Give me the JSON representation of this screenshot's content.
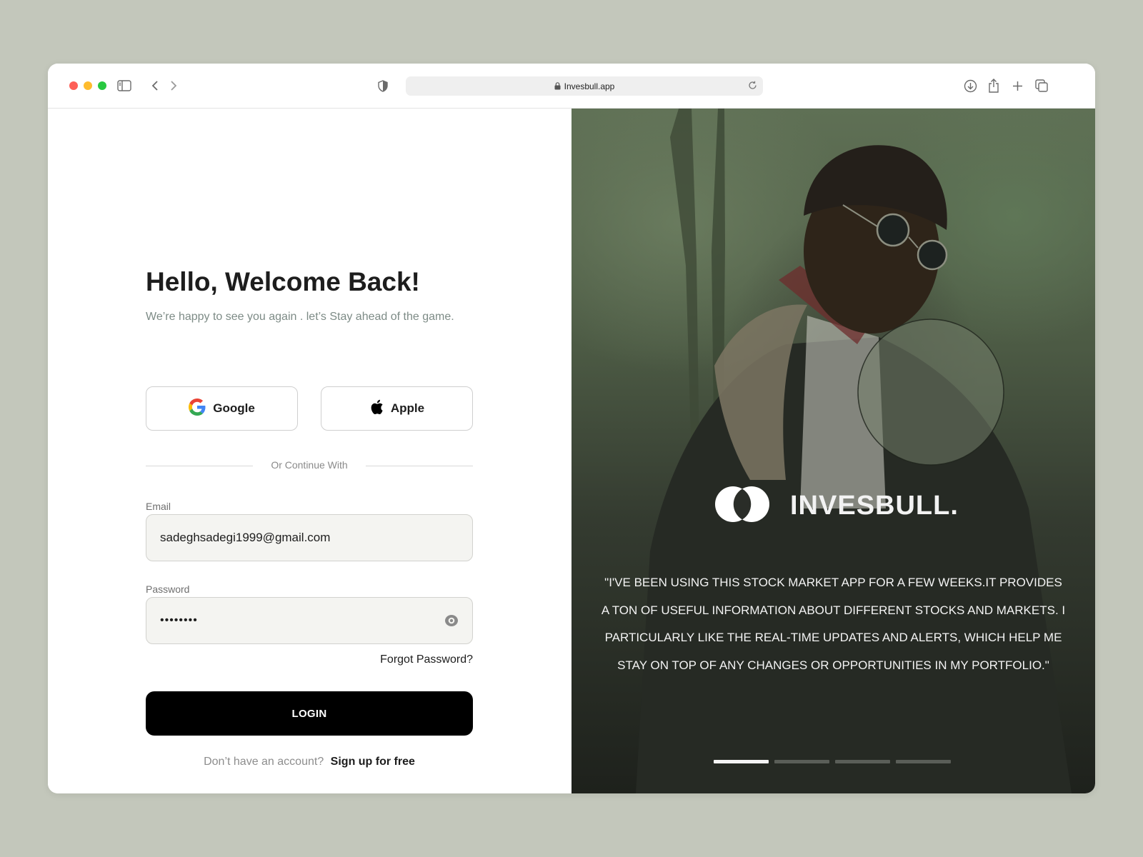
{
  "browser": {
    "url": "Invesbull.app",
    "icons": [
      "sidebar-icon",
      "back-icon",
      "forward-icon",
      "shield-icon",
      "lock-icon",
      "reload-icon",
      "download-icon",
      "share-icon",
      "new-tab-icon",
      "tabs-overview-icon"
    ]
  },
  "login": {
    "greeting_plain": "Hello,",
    "greeting_bold": "Welcome Back!",
    "subtitle": "We’re happy to see you again . let’s  Stay ahead of the game.",
    "google_label": "Google",
    "apple_label": "Apple",
    "divider_text": "Or Continue With",
    "email_label": "Email",
    "email_value": "sadeghsadegi1999@gmail.com",
    "password_label": "Password",
    "password_value": "••••••••",
    "forgot_label": "Forgot Password?",
    "login_label": "LOGIN",
    "no_account_text": "Don’t have an account?",
    "signup_label": "Sign up for free"
  },
  "promo": {
    "brand_name": "INVESBULL.",
    "quote": "\"I'VE BEEN USING THIS STOCK MARKET APP FOR A FEW WEEKS.IT PROVIDES A TON OF USEFUL INFORMATION ABOUT DIFFERENT STOCKS AND MARKETS. I PARTICULARLY LIKE THE REAL-TIME UPDATES AND ALERTS, WHICH HELP ME STAY ON TOP OF ANY CHANGES OR OPPORTUNITIES IN MY PORTFOLIO.\"",
    "pager_total": 4,
    "pager_active": 1
  },
  "colors": {
    "page_bg": "#c3c7bb",
    "accent": "#000000",
    "muted_text": "#7d8b86"
  }
}
